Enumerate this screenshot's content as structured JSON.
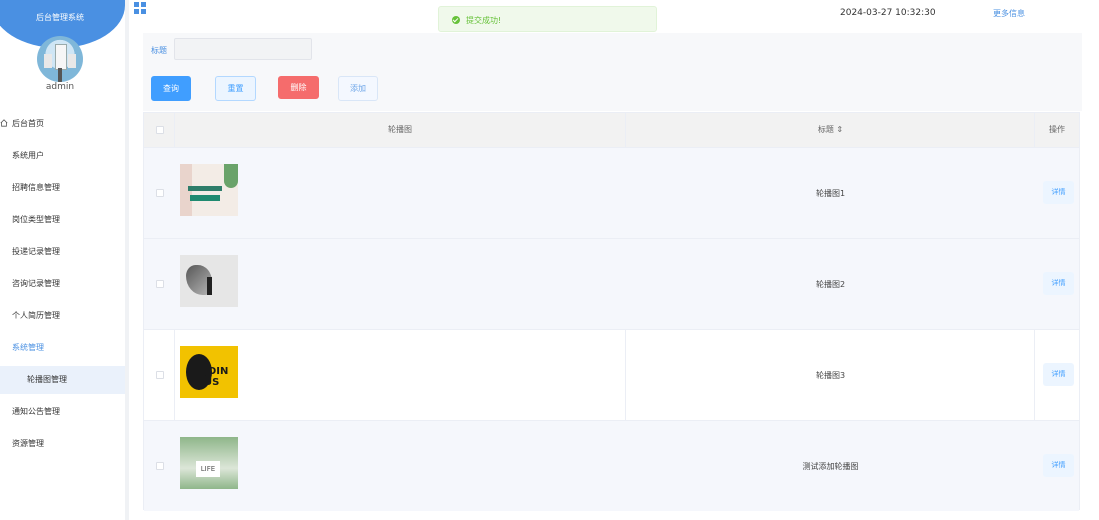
{
  "sidebar": {
    "brand": "后台管理系统",
    "username": "admin",
    "items": [
      {
        "label": "后台首页"
      },
      {
        "label": "系统用户"
      },
      {
        "label": "招聘信息管理"
      },
      {
        "label": "岗位类型管理"
      },
      {
        "label": "投递记录管理"
      },
      {
        "label": "咨询记录管理"
      },
      {
        "label": "个人简历管理"
      },
      {
        "label": "系统管理"
      },
      {
        "label": "通知公告管理"
      },
      {
        "label": "资源管理"
      }
    ],
    "submenu": {
      "label": "轮播图管理"
    }
  },
  "header": {
    "datetime": "2024-03-27 10:32:30",
    "more": "更多信息"
  },
  "toast": {
    "message": "提交成功!"
  },
  "filter": {
    "label": "标题",
    "value": ""
  },
  "buttons": {
    "search": "查询",
    "reset": "重置",
    "delete": "删除",
    "add": "添加"
  },
  "table": {
    "headers": {
      "image": "轮播图",
      "title": "标题 ⇕",
      "actions": "操作"
    },
    "detail_label": "详情",
    "rows": [
      {
        "title": "轮播图1"
      },
      {
        "title": "轮播图2"
      },
      {
        "title": "轮播图3"
      },
      {
        "title": "测试添加轮播图"
      }
    ]
  },
  "thumb_texts": {
    "t3": "JOIN US",
    "t4": "LIFE"
  },
  "colors": {
    "primary": "#409eff",
    "danger": "#f56c6c",
    "success": "#67c23a",
    "brand": "#4a90e2"
  }
}
